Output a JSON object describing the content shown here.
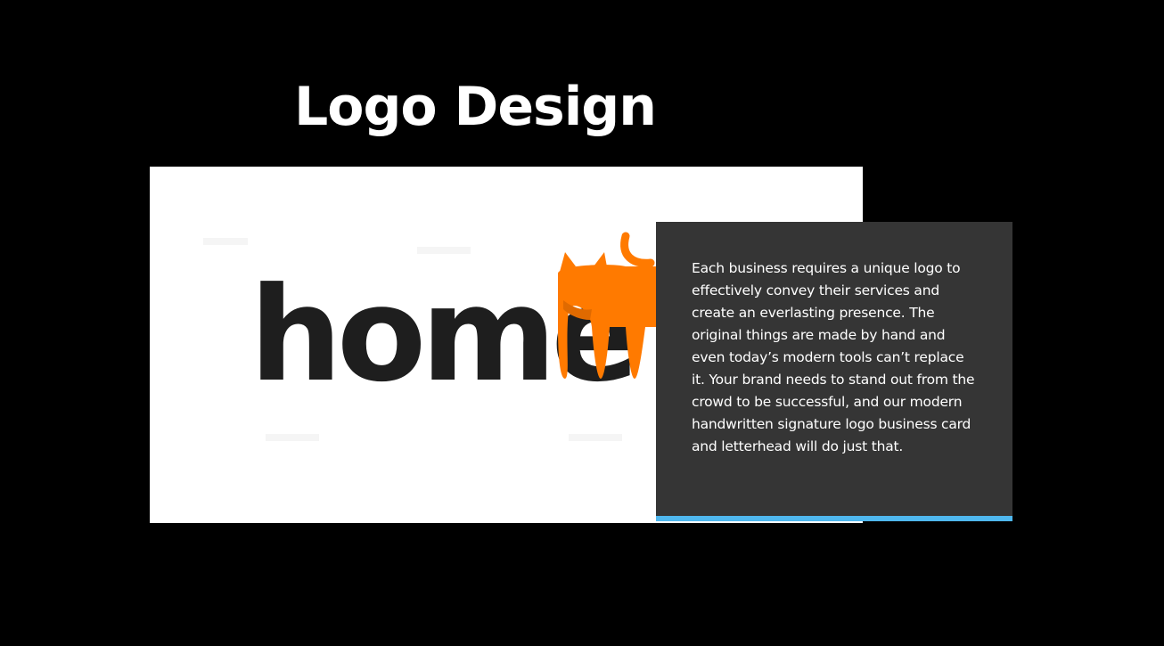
{
  "section": {
    "title": "Logo Design"
  },
  "logo": {
    "wordmark": "home",
    "icon": "cat-icon",
    "text_color": "#1e1e1e",
    "icon_color": "#ff7a00"
  },
  "description": {
    "text": "Each business requires a unique logo to effectively convey their services and create an everlasting presence. The original things are made by hand and even today’s modern tools can’t replace it. Your brand needs to stand out from the crowd to be successful, and our modern handwritten signature logo business card and letterhead will do just that."
  },
  "colors": {
    "background": "#000000",
    "panel": "#353535",
    "accent": "#4fb7ee"
  }
}
